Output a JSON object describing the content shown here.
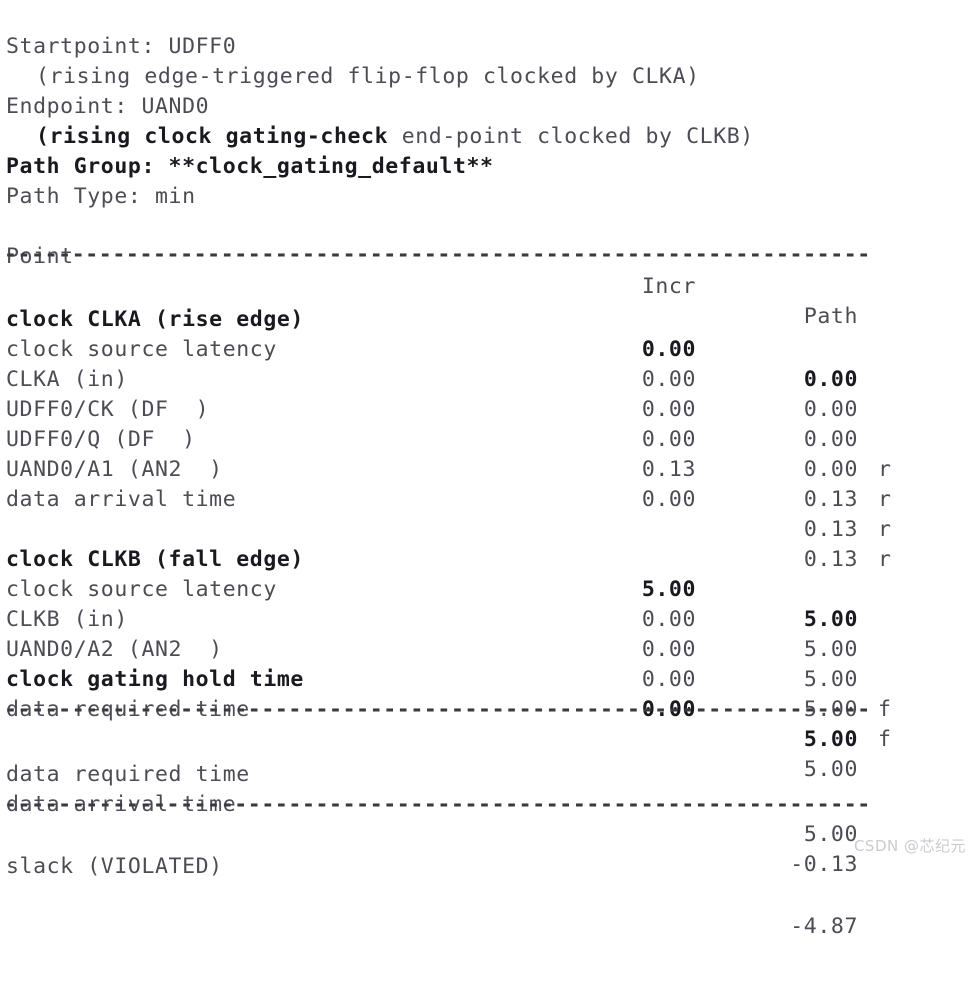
{
  "report": {
    "header_lines": [
      {
        "indent": false,
        "bold": false,
        "text": "Startpoint: UDFF0"
      },
      {
        "indent": true,
        "bold": false,
        "text": "(rising edge-triggered flip-flop clocked by CLKA)"
      },
      {
        "indent": false,
        "bold": false,
        "text": "Endpoint: UAND0"
      },
      {
        "indent": true,
        "bold": false,
        "text": "",
        "segments": [
          {
            "bold": true,
            "text": "(rising clock gating-check"
          },
          {
            "bold": false,
            "text": " end-point clocked by CLKB)"
          }
        ]
      },
      {
        "indent": false,
        "bold": true,
        "text": "Path Group: **clock_gating_default**"
      },
      {
        "indent": false,
        "bold": false,
        "text": "Path Type: min"
      }
    ],
    "columns": {
      "point": "Point",
      "incr": "Incr",
      "path": "Path"
    },
    "rule": "----------------------------------------------------------------",
    "launch_block": [
      {
        "point": "clock CLKA (rise edge)",
        "incr": "0.00",
        "path": "0.00",
        "edge": "",
        "bold": true
      },
      {
        "point": "clock source latency",
        "incr": "0.00",
        "path": "0.00",
        "edge": "",
        "bold": false
      },
      {
        "point": "CLKA (in)",
        "incr": "0.00",
        "path": "0.00",
        "edge": "r",
        "bold": false
      },
      {
        "point": "UDFF0/CK (DF  )",
        "incr": "0.00",
        "path": "0.00",
        "edge": "r",
        "bold": false
      },
      {
        "point": "UDFF0/Q (DF  )",
        "incr": "0.13",
        "path": "0.13",
        "edge": "r",
        "bold": false
      },
      {
        "point": "UAND0/A1 (AN2  )",
        "incr": "0.00",
        "path": "0.13",
        "edge": "r",
        "bold": false
      },
      {
        "point": "data arrival time",
        "incr": "",
        "path": "0.13",
        "edge": "",
        "bold": false
      }
    ],
    "capture_block": [
      {
        "point": "clock CLKB (fall edge)",
        "incr": "5.00",
        "path": "5.00",
        "edge": "",
        "bold": true
      },
      {
        "point": "clock source latency",
        "incr": "0.00",
        "path": "5.00",
        "edge": "",
        "bold": false
      },
      {
        "point": "CLKB (in)",
        "incr": "0.00",
        "path": "5.00",
        "edge": "f",
        "bold": false
      },
      {
        "point": "UAND0/A2 (AN2  )",
        "incr": "0.00",
        "path": "5.00",
        "edge": "f",
        "bold": false
      },
      {
        "point": "clock gating hold time",
        "incr": "0.00",
        "path": "5.00",
        "edge": "",
        "bold": true
      },
      {
        "point": "data required time",
        "incr": "",
        "path": "5.00",
        "edge": "",
        "bold": false
      }
    ],
    "summary_block": [
      {
        "point": "data required time",
        "incr": "",
        "path": "5.00",
        "edge": "",
        "bold": false
      },
      {
        "point": "data arrival time",
        "incr": "",
        "path": "-0.13",
        "edge": "",
        "bold": false
      }
    ],
    "slack": {
      "point": "slack (VIOLATED)",
      "incr": "",
      "path": "-4.87",
      "edge": "",
      "bold": false
    },
    "watermark": "CSDN @芯纪元"
  }
}
